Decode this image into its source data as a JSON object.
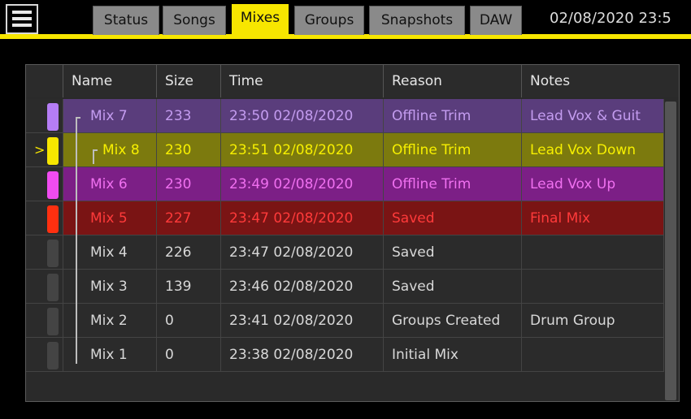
{
  "header": {
    "menu_icon": "hamburger-menu-icon",
    "tabs": [
      {
        "label": "Status",
        "active": false
      },
      {
        "label": "Songs",
        "active": false
      },
      {
        "label": "Mixes",
        "active": true
      },
      {
        "label": "Groups",
        "active": false
      },
      {
        "label": "Snapshots",
        "active": false
      },
      {
        "label": "DAW",
        "active": false
      }
    ],
    "datetime": "02/08/2020 23:5",
    "accent_color": "#f7e600"
  },
  "table": {
    "columns": [
      "Name",
      "Size",
      "Time",
      "Reason",
      "Notes"
    ],
    "rows": [
      {
        "marker": "",
        "name": "Mix 7",
        "size": "233",
        "time": "23:50 02/08/2020",
        "reason": "Offline Trim",
        "notes": "Lead Vox & Guit",
        "color": "#b57df5",
        "bg": "#5a3d7c",
        "text": "#c49cf0"
      },
      {
        "marker": ">",
        "name": "Mix 8",
        "size": "230",
        "time": "23:51 02/08/2020",
        "reason": "Offline Trim",
        "notes": "Lead Vox Down",
        "color": "#f7e600",
        "bg": "#7c7a0e",
        "text": "#f7f000"
      },
      {
        "marker": "",
        "name": "Mix 6",
        "size": "230",
        "time": "23:49 02/08/2020",
        "reason": "Offline Trim",
        "notes": "Lead Vox Up",
        "color": "#f04cf0",
        "bg": "#7c1f86",
        "text": "#f070f0"
      },
      {
        "marker": "",
        "name": "Mix 5",
        "size": "227",
        "time": "23:47 02/08/2020",
        "reason": "Saved",
        "notes": "Final Mix",
        "color": "#ff3010",
        "bg": "#7a1414",
        "text": "#ff3a3a"
      },
      {
        "marker": "",
        "name": "Mix 4",
        "size": "226",
        "time": "23:47 02/08/2020",
        "reason": "Saved",
        "notes": "",
        "color": "#444444",
        "bg": "#2b2b2b",
        "text": "#d8d8d8"
      },
      {
        "marker": "",
        "name": "Mix 3",
        "size": "139",
        "time": "23:46 02/08/2020",
        "reason": "Saved",
        "notes": "",
        "color": "#444444",
        "bg": "#2b2b2b",
        "text": "#d8d8d8"
      },
      {
        "marker": "",
        "name": "Mix 2",
        "size": "0",
        "time": "23:41 02/08/2020",
        "reason": "Groups Created",
        "notes": "Drum Group",
        "color": "#444444",
        "bg": "#2b2b2b",
        "text": "#d8d8d8"
      },
      {
        "marker": "",
        "name": "Mix 1",
        "size": "0",
        "time": "23:38 02/08/2020",
        "reason": "Initial Mix",
        "notes": "",
        "color": "#444444",
        "bg": "#2b2b2b",
        "text": "#d8d8d8"
      }
    ]
  }
}
